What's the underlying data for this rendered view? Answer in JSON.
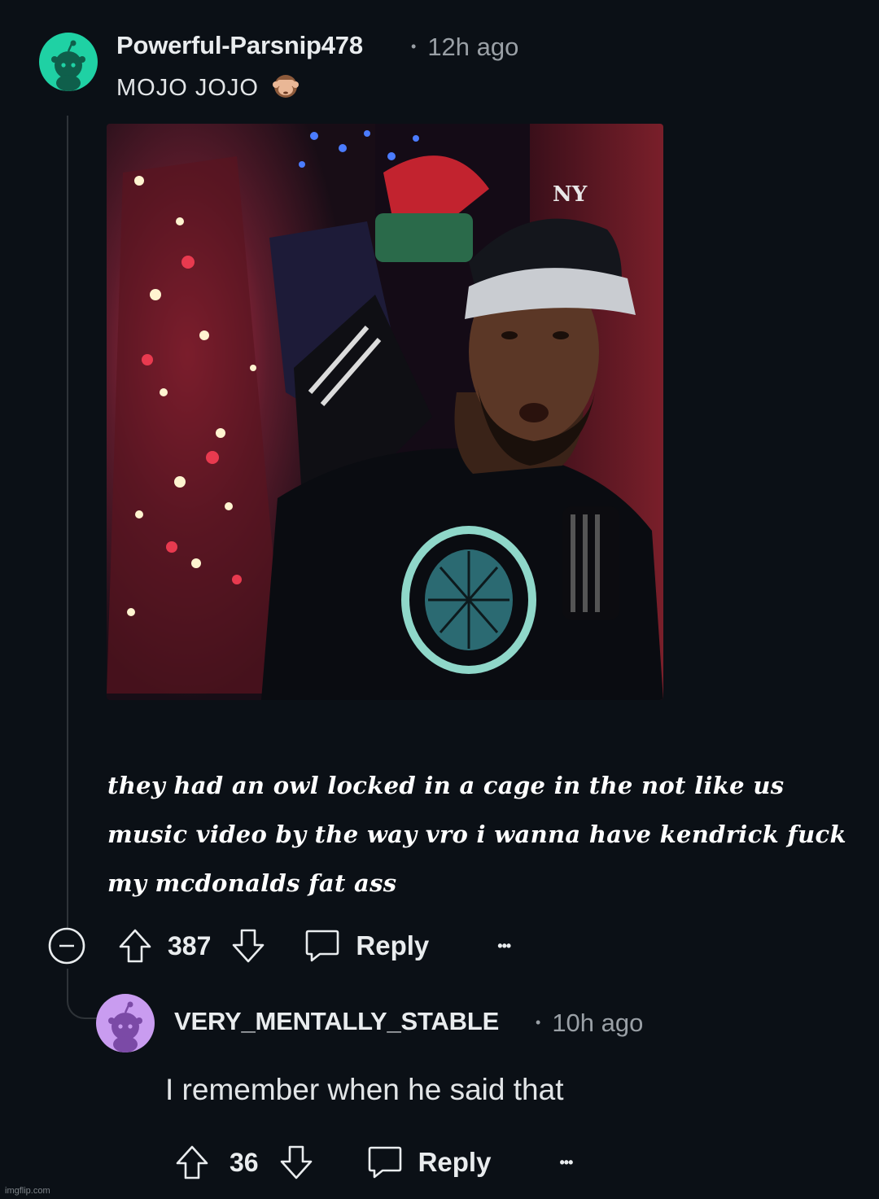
{
  "comment": {
    "username": "Powerful-Parsnip478",
    "dot": "•",
    "time": "12h ago",
    "text": "MOJO JOJO",
    "text_emoji_icon": "see-no-evil-monkey-icon",
    "avatar_color": "#1fd1a4",
    "media_caption": "they had an owl locked in a cage in the not like us music video by the way vro i wanna have kendrick fuck my mcdonalds fat ass",
    "votes": "387",
    "reply_label": "Reply",
    "more_label": "•••"
  },
  "reply": {
    "username": "VERY_MENTALLY_STABLE",
    "dot": "•",
    "time": "10h ago",
    "text": "I remember when he said that",
    "avatar_color": "#c99cf0",
    "votes": "36",
    "reply_label": "Reply",
    "more_label": "•••"
  },
  "watermark": "imgflip.com",
  "colors": {
    "background": "#0b1016",
    "thread_line": "#2e3338",
    "text_primary": "#e9ecee",
    "text_secondary": "#9aa0a6"
  }
}
